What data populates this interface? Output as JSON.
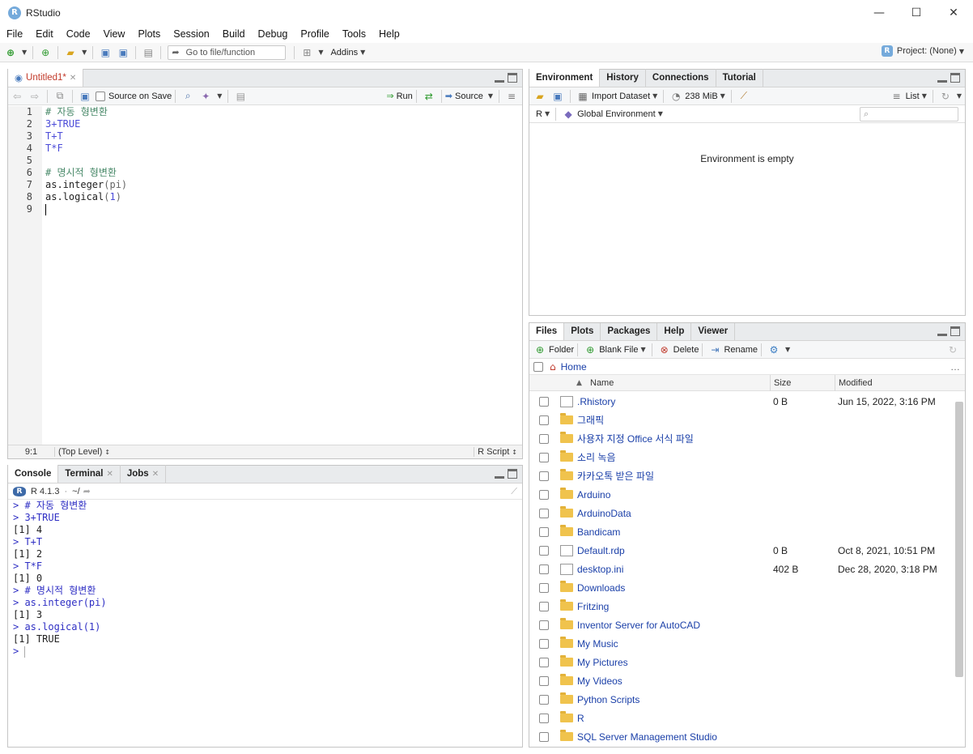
{
  "window": {
    "title": "RStudio",
    "minimize": "—",
    "maximize": "☐",
    "close": "✕"
  },
  "menu": [
    "File",
    "Edit",
    "Code",
    "View",
    "Plots",
    "Session",
    "Build",
    "Debug",
    "Profile",
    "Tools",
    "Help"
  ],
  "toolbar": {
    "goto_placeholder": "Go to file/function",
    "addins": "Addins",
    "project": "Project: (None)"
  },
  "editor": {
    "tab": "Untitled1*",
    "source_on_save": "Source on Save",
    "run": "Run",
    "source": "Source",
    "line_numbers": [
      "1",
      "2",
      "3",
      "4",
      "5",
      "6",
      "7",
      "8",
      "9"
    ],
    "lines": [
      {
        "text": "# 자동 형변환",
        "kind": "comment"
      },
      {
        "text": "3+TRUE",
        "kind": "num"
      },
      {
        "text": "T+T",
        "kind": "num"
      },
      {
        "text": "T*F",
        "kind": "num"
      },
      {
        "text": "",
        "kind": "plain"
      },
      {
        "text": "# 명시적 형변환",
        "kind": "comment"
      },
      {
        "text": "as.integer(pi)",
        "kind": "plain"
      },
      {
        "text": "as.logical(1)",
        "kind": "plain"
      },
      {
        "text": "",
        "kind": "plain"
      }
    ],
    "status_pos": "9:1",
    "status_scope": "(Top Level)",
    "status_type": "R Script"
  },
  "console": {
    "tabs": [
      "Console",
      "Terminal",
      "Jobs"
    ],
    "r_version": "R 4.1.3",
    "path": "~/",
    "lines": [
      {
        "text": "> # 자동 형변환",
        "kind": "input"
      },
      {
        "text": "> 3+TRUE",
        "kind": "input"
      },
      {
        "text": "[1] 4",
        "kind": "output"
      },
      {
        "text": "> T+T",
        "kind": "input"
      },
      {
        "text": "[1] 2",
        "kind": "output"
      },
      {
        "text": "> T*F",
        "kind": "input"
      },
      {
        "text": "[1] 0",
        "kind": "output"
      },
      {
        "text": "> # 명시적 형변환",
        "kind": "input"
      },
      {
        "text": "> as.integer(pi)",
        "kind": "input"
      },
      {
        "text": "[1] 3",
        "kind": "output"
      },
      {
        "text": "> as.logical(1)",
        "kind": "input"
      },
      {
        "text": "[1] TRUE",
        "kind": "output"
      },
      {
        "text": "> ",
        "kind": "input"
      }
    ]
  },
  "environment": {
    "tabs": [
      "Environment",
      "History",
      "Connections",
      "Tutorial"
    ],
    "import_dataset": "Import Dataset",
    "memory": "238 MiB",
    "view_mode": "List",
    "language": "R",
    "scope": "Global Environment",
    "empty_msg": "Environment is empty"
  },
  "files": {
    "tabs": [
      "Files",
      "Plots",
      "Packages",
      "Help",
      "Viewer"
    ],
    "actions": {
      "folder": "Folder",
      "blank_file": "Blank File",
      "delete": "Delete",
      "rename": "Rename"
    },
    "breadcrumb": "Home",
    "columns": {
      "name": "Name",
      "size": "Size",
      "modified": "Modified"
    },
    "rows": [
      {
        "name": ".Rhistory",
        "size": "0 B",
        "modified": "Jun 15, 2022, 3:16 PM",
        "type": "history"
      },
      {
        "name": "그래픽",
        "size": "",
        "modified": "",
        "type": "folder"
      },
      {
        "name": "사용자 지정 Office 서식 파일",
        "size": "",
        "modified": "",
        "type": "folder"
      },
      {
        "name": "소리 녹음",
        "size": "",
        "modified": "",
        "type": "folder"
      },
      {
        "name": "카카오톡 받은 파일",
        "size": "",
        "modified": "",
        "type": "folder"
      },
      {
        "name": "Arduino",
        "size": "",
        "modified": "",
        "type": "folder"
      },
      {
        "name": "ArduinoData",
        "size": "",
        "modified": "",
        "type": "folder"
      },
      {
        "name": "Bandicam",
        "size": "",
        "modified": "",
        "type": "folder"
      },
      {
        "name": "Default.rdp",
        "size": "0 B",
        "modified": "Oct 8, 2021, 10:51 PM",
        "type": "file"
      },
      {
        "name": "desktop.ini",
        "size": "402 B",
        "modified": "Dec 28, 2020, 3:18 PM",
        "type": "settings"
      },
      {
        "name": "Downloads",
        "size": "",
        "modified": "",
        "type": "folder"
      },
      {
        "name": "Fritzing",
        "size": "",
        "modified": "",
        "type": "folder"
      },
      {
        "name": "Inventor Server for AutoCAD",
        "size": "",
        "modified": "",
        "type": "folder"
      },
      {
        "name": "My Music",
        "size": "",
        "modified": "",
        "type": "folder"
      },
      {
        "name": "My Pictures",
        "size": "",
        "modified": "",
        "type": "folder"
      },
      {
        "name": "My Videos",
        "size": "",
        "modified": "",
        "type": "folder"
      },
      {
        "name": "Python Scripts",
        "size": "",
        "modified": "",
        "type": "folder"
      },
      {
        "name": "R",
        "size": "",
        "modified": "",
        "type": "folder"
      },
      {
        "name": "SQL Server Management Studio",
        "size": "",
        "modified": "",
        "type": "folder"
      }
    ]
  }
}
